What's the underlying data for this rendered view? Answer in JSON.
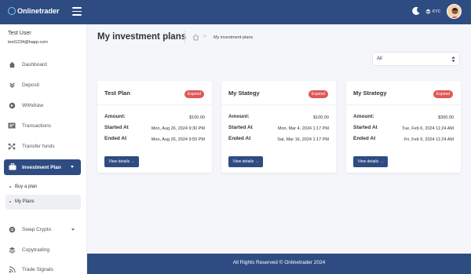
{
  "app": {
    "brand": "Onlinetrader"
  },
  "topbar": {
    "kyc_label": "KYC"
  },
  "user": {
    "name": "Test User",
    "email": "test1234@happ.com"
  },
  "sidebar": {
    "items": [
      {
        "label": "Dashboard",
        "icon": "home-icon"
      },
      {
        "label": "Deposit",
        "icon": "download-icon"
      },
      {
        "label": "Withdraw",
        "icon": "withdraw-icon"
      },
      {
        "label": "Transactions",
        "icon": "transactions-icon"
      },
      {
        "label": "Transfer funds",
        "icon": "transfer-icon"
      }
    ],
    "active": {
      "label": "Investment Plan",
      "icon": "briefcase-icon"
    },
    "sub_items": [
      {
        "label": "Buy a plan"
      },
      {
        "label": "My Plans"
      }
    ],
    "after_items": [
      {
        "label": "Swap Crypto",
        "icon": "swap-icon"
      },
      {
        "label": "Copytrading",
        "icon": "layers-icon"
      },
      {
        "label": "Trade Signals",
        "icon": "rss-icon"
      }
    ]
  },
  "page": {
    "title": "My investment plans",
    "breadcrumb_current": "My investment plans",
    "breadcrumb_separator": ">"
  },
  "filter": {
    "selected": "All"
  },
  "labels": {
    "amount": "Amount:",
    "started": "Started At",
    "ended": "Ended At",
    "view_details": "View details →"
  },
  "plans": [
    {
      "name": "Test Plan",
      "status": "Expired",
      "amount": "$100.00",
      "started": "Mon, Aug 26, 2024 9:30 PM",
      "ended": "Mon, Aug 26, 2024 9:50 PM"
    },
    {
      "name": "My Stategy",
      "status": "Expired",
      "amount": "$100.00",
      "started": "Mon, Mar 4, 2024 1:17 PM",
      "ended": "Sat, Mar 16, 2024 1:17 PM"
    },
    {
      "name": "My Strategy",
      "status": "Expired",
      "amount": "$300.00",
      "started": "Tue, Feb 6, 2024 11:24 AM",
      "ended": "Fri, Feb 9, 2024 11:24 AM"
    }
  ],
  "footer": {
    "text": "All Rights Reserved © Onlinetrader 2024"
  },
  "colors": {
    "primary": "#2e4c82",
    "badge": "#e05757",
    "background": "#f5f6fa"
  }
}
